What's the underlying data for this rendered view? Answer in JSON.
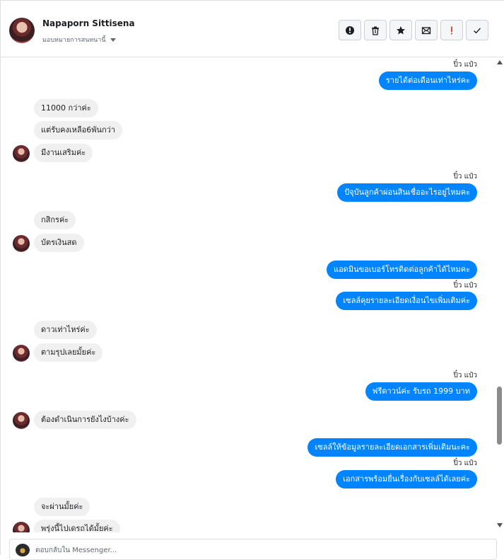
{
  "header": {
    "name": "Napaporn Sittisena",
    "assign_label": "มอบหมายการสนทนานี้",
    "tools": [
      {
        "icon": "alert-circle-icon",
        "name": "spam-button"
      },
      {
        "icon": "trash-icon",
        "name": "delete-button"
      },
      {
        "icon": "star-icon",
        "name": "star-button"
      },
      {
        "icon": "mark-unread-icon",
        "name": "mark-unread-button"
      },
      {
        "icon": "exclamation-icon",
        "name": "flag-button"
      },
      {
        "icon": "check-icon",
        "name": "done-button"
      }
    ]
  },
  "messages": {
    "s1": "ปิ๋ว แป๋ว",
    "m1": "รายได้ต่อเดือนเท่าไหร่คะ",
    "m2": "11000 กว่าค่ะ",
    "m3": "แต่รับคงเหลือ6พันกว่า",
    "m4": "มีงานเสริมค่ะ",
    "s2": "ปิ๋ว แป๋ว",
    "m5": "ปัจุบันลูกค้าผ่อนสินเชื่ออะไรอยู่ไหมคะ",
    "m6": "กสิกรค่ะ",
    "m7": "บัตรเงินสด",
    "m8": "แอดมินขอเบอร์โทรติดต่อลูกค้าได้ไหมคะ",
    "s3": "ปิ๋ว แป๋ว",
    "m9": "เซลล์คุยรายละเอียดเงื่อนไขเพิ่มเติมค่ะ",
    "m10": "ดาวเท่าไหร่ค่ะ",
    "m11": "ตามรุปเลยมั้ยค่ะ",
    "s4": "ปิ๋ว แป๋ว",
    "m12": "ฟรีดาวน์ค่ะ รับรถ 1999 บาท",
    "m13": "ต้องดำเนินการยังไงบ้างค่ะ",
    "m14": "เซลล์ให้ข้อมูลรายละเอียดเอกสารเพิ่มเติมนะคะ",
    "s5": "ปิ๋ว แป๋ว",
    "m15": "เอกสารพร้อมยื่นเรื่องกับเซลล์ได้เลยค่ะ",
    "m16": "จะผ่านมั้ยค่ะ",
    "m17": "พรุ่งนี้ไปเดรถได้มั้ยค่ะ"
  },
  "composer": {
    "placeholder": "ตอบกลับใน Messenger..."
  },
  "colors": {
    "outgoing_bubble": "#0084ff",
    "incoming_bubble": "#f1f0f0",
    "border": "#dddfe2"
  }
}
